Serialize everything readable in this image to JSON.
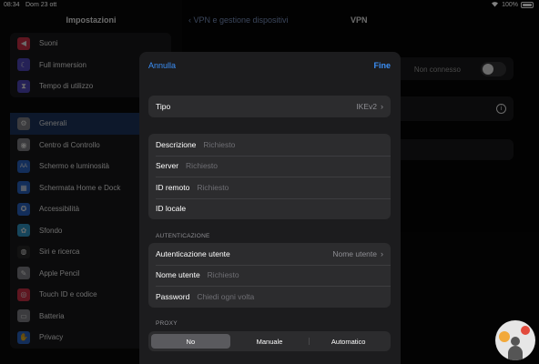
{
  "status_bar": {
    "time": "08:34",
    "date": "Dom 23 ott",
    "battery": "100%"
  },
  "sidebar": {
    "title": "Impostazioni",
    "group1": [
      {
        "label": "Suoni",
        "icon": "speaker-icon",
        "color": "#e0364e",
        "glyph": "◀"
      },
      {
        "label": "Full immersion",
        "icon": "moon-icon",
        "color": "#5a4fcf",
        "glyph": "☾"
      },
      {
        "label": "Tempo di utilizzo",
        "icon": "hourglass-icon",
        "color": "#5a4fcf",
        "glyph": "⧗"
      }
    ],
    "group2": [
      {
        "label": "Generali",
        "icon": "gear-icon",
        "color": "#8e8e93",
        "glyph": "⚙",
        "selected": true
      },
      {
        "label": "Centro di Controllo",
        "icon": "control-center-icon",
        "color": "#8e8e93",
        "glyph": "◉"
      },
      {
        "label": "Schermo e luminosità",
        "icon": "display-icon",
        "color": "#2f6fd6",
        "glyph": "AA"
      },
      {
        "label": "Schermata Home e Dock",
        "icon": "home-dock-icon",
        "color": "#2f6fd6",
        "glyph": "▦"
      },
      {
        "label": "Accessibilità",
        "icon": "accessibility-icon",
        "color": "#2f6fd6",
        "glyph": "✪"
      },
      {
        "label": "Sfondo",
        "icon": "wallpaper-icon",
        "color": "#35a4d9",
        "glyph": "✿"
      },
      {
        "label": "Siri e ricerca",
        "icon": "siri-icon",
        "color": "#2b2b2b",
        "glyph": "◍"
      },
      {
        "label": "Apple Pencil",
        "icon": "pencil-icon",
        "color": "#8e8e93",
        "glyph": "✎"
      },
      {
        "label": "Touch ID e codice",
        "icon": "fingerprint-icon",
        "color": "#e0364e",
        "glyph": "◎"
      },
      {
        "label": "Batteria",
        "icon": "battery-icon",
        "color": "#8e8e93",
        "glyph": "▭"
      },
      {
        "label": "Privacy",
        "icon": "hand-icon",
        "color": "#2f6fd6",
        "glyph": "✋"
      }
    ]
  },
  "detail": {
    "back_label": "VPN e gestione dispositivi",
    "title": "VPN",
    "status_label": "Non connesso"
  },
  "sheet": {
    "cancel_label": "Annulla",
    "done_label": "Fine",
    "type": {
      "label": "Tipo",
      "value": "IKEv2"
    },
    "fields": [
      {
        "label": "Descrizione",
        "placeholder": "Richiesto"
      },
      {
        "label": "Server",
        "placeholder": "Richiesto"
      },
      {
        "label": "ID remoto",
        "placeholder": "Richiesto"
      },
      {
        "label": "ID locale",
        "placeholder": ""
      }
    ],
    "auth_header": "AUTENTICAZIONE",
    "auth": {
      "method_label": "Autenticazione utente",
      "method_value": "Nome utente",
      "username_label": "Nome utente",
      "username_placeholder": "Richiesto",
      "password_label": "Password",
      "password_placeholder": "Chiedi ogni volta"
    },
    "proxy_header": "PROXY",
    "proxy_options": [
      "No",
      "Manuale",
      "Automatico"
    ],
    "proxy_selected": "No"
  }
}
